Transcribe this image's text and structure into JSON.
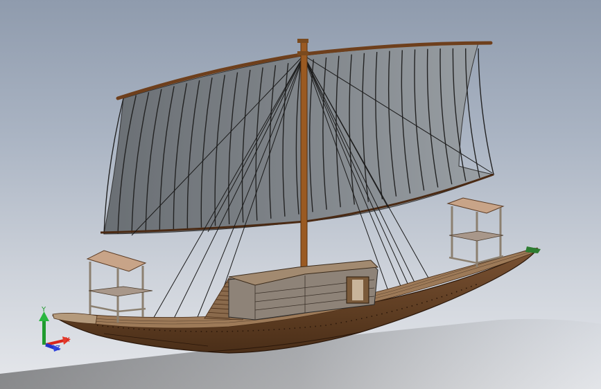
{
  "view": {
    "background_top": "#8f9bad",
    "background_bottom": "#e6e8ec"
  },
  "triad": {
    "x_label": "X",
    "y_label": "Y",
    "z_label": "Z",
    "x_color": "#d9261c",
    "y_color": "#1f9b2e",
    "z_color": "#2334c8"
  },
  "model": {
    "hull_color": "#6b4526",
    "deck_color": "#8a6a4c",
    "sail_color": "#7c8186",
    "mast_color": "#9a5a22",
    "cabin_color": "#8e8378"
  }
}
